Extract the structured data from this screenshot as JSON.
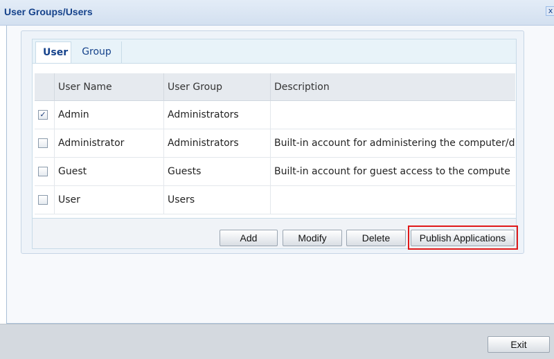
{
  "window": {
    "title": "User Groups/Users",
    "close_label": "x"
  },
  "tabs": [
    {
      "label": "User",
      "active": true
    },
    {
      "label": "Group",
      "active": false
    }
  ],
  "grid": {
    "columns": [
      "User Name",
      "User Group",
      "Description"
    ],
    "rows": [
      {
        "checked": true,
        "mark": "✓",
        "user_name": "Admin",
        "user_group": "Administrators",
        "description": ""
      },
      {
        "checked": false,
        "mark": "",
        "user_name": "Administrator",
        "user_group": "Administrators",
        "description": "Built-in account for administering the computer/d"
      },
      {
        "checked": false,
        "mark": "",
        "user_name": "Guest",
        "user_group": "Guests",
        "description": "Built-in account for guest access to the compute"
      },
      {
        "checked": false,
        "mark": "",
        "user_name": "User",
        "user_group": "Users",
        "description": ""
      }
    ]
  },
  "toolbar": {
    "add": "Add",
    "modify": "Modify",
    "delete": "Delete",
    "publish": "Publish Applications"
  },
  "footer": {
    "exit": "Exit"
  },
  "colors": {
    "title_text": "#15428b",
    "highlight": "#e01818"
  }
}
